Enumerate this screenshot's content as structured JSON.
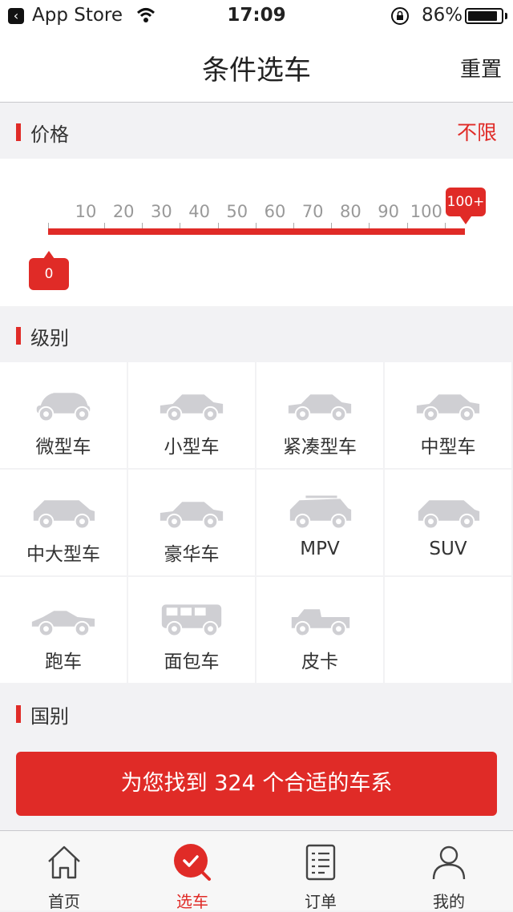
{
  "status": {
    "app": "App Store",
    "time": "17:09",
    "battery": "86%"
  },
  "nav": {
    "title": "条件选车",
    "reset": "重置"
  },
  "price": {
    "title": "价格",
    "extra": "不限",
    "ticks": [
      "10",
      "20",
      "30",
      "40",
      "50",
      "60",
      "70",
      "80",
      "90",
      "100"
    ],
    "min_label": "0",
    "max_label": "100+"
  },
  "level": {
    "title": "级别",
    "items": [
      {
        "label": "微型车",
        "icon": "mini-car-icon"
      },
      {
        "label": "小型车",
        "icon": "small-car-icon"
      },
      {
        "label": "紧凑型车",
        "icon": "compact-car-icon"
      },
      {
        "label": "中型车",
        "icon": "midsize-car-icon"
      },
      {
        "label": "中大型车",
        "icon": "large-car-icon"
      },
      {
        "label": "豪华车",
        "icon": "luxury-car-icon"
      },
      {
        "label": "MPV",
        "icon": "mpv-icon"
      },
      {
        "label": "SUV",
        "icon": "suv-icon"
      },
      {
        "label": "跑车",
        "icon": "sports-car-icon"
      },
      {
        "label": "面包车",
        "icon": "van-icon"
      },
      {
        "label": "皮卡",
        "icon": "pickup-icon"
      }
    ]
  },
  "country": {
    "title": "国别"
  },
  "cta": {
    "label": "为您找到 324 个合适的车系"
  },
  "tabs": [
    {
      "label": "首页",
      "icon": "home-icon"
    },
    {
      "label": "选车",
      "icon": "select-car-icon"
    },
    {
      "label": "订单",
      "icon": "orders-icon"
    },
    {
      "label": "我的",
      "icon": "profile-icon"
    }
  ]
}
